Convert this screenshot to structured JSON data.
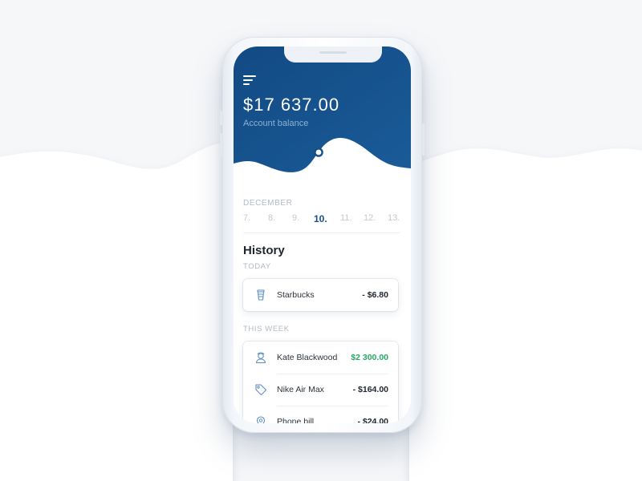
{
  "colors": {
    "header": "#16508a",
    "accent": "#1b4f86",
    "positive": "#2aa866",
    "background": "#f6f7f9"
  },
  "header": {
    "menu_icon": "hamburger-menu-icon",
    "balance": "$17 637.00",
    "balance_label": "Account balance"
  },
  "calendar": {
    "month": "DECEMBER",
    "days": [
      "7.",
      "8.",
      "9.",
      "10.",
      "11.",
      "12.",
      "13."
    ],
    "selected": "10."
  },
  "history": {
    "title": "History",
    "sections": [
      {
        "label": "TODAY",
        "items": [
          {
            "icon": "coffee-cup-icon",
            "name": "Starbucks",
            "amount": "- $6.80",
            "positive": false
          }
        ]
      },
      {
        "label": "THIS WEEK",
        "items": [
          {
            "icon": "person-icon",
            "name": "Kate Blackwood",
            "amount": "$2 300.00",
            "positive": true
          },
          {
            "icon": "price-tag-icon",
            "name": "Nike Air Max",
            "amount": "- $164.00",
            "positive": false
          },
          {
            "icon": "location-pin-icon",
            "name": "Phone bill",
            "amount": "- $24.00",
            "positive": false
          }
        ]
      }
    ]
  }
}
